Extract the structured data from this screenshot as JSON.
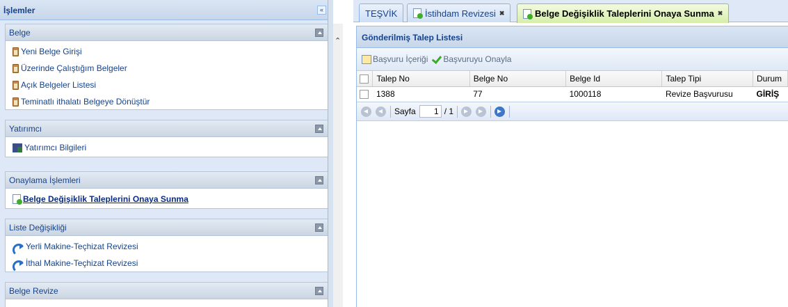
{
  "west": {
    "title": "İşlemler",
    "collapse_glyph": "«",
    "panels": [
      {
        "title": "Belge",
        "items": [
          {
            "label": "Yeni Belge Girişi",
            "icon": "clipboard-icon"
          },
          {
            "label": "Üzerinde Çalıştığım Belgeler",
            "icon": "clipboard-icon"
          },
          {
            "label": "Açık Belgeler Listesi",
            "icon": "clipboard-icon"
          },
          {
            "label": "Teminatlı ithalatı Belgeye Dönüştür",
            "icon": "clipboard-icon"
          }
        ]
      },
      {
        "title": "Yatırımcı",
        "items": [
          {
            "label": "Yatırımcı Bilgileri",
            "icon": "building-icon"
          }
        ]
      },
      {
        "title": "Onaylama İşlemleri",
        "items": [
          {
            "label": "Belge Değişiklik Taleplerini Onaya Sunma",
            "icon": "document-go-icon"
          }
        ]
      },
      {
        "title": "Liste Değişikliği",
        "items": [
          {
            "label": "Yerli Makine-Teçhizat Revizesi",
            "icon": "redo-arrow-icon"
          },
          {
            "label": "İthal Makine-Teçhizat Revizesi",
            "icon": "redo-arrow-icon"
          }
        ]
      },
      {
        "title": "Belge Revize",
        "items": []
      }
    ]
  },
  "tabs": [
    {
      "label": "TEŞVİK"
    },
    {
      "label": "İstihdam Revizesi",
      "close": "✖"
    },
    {
      "label": "Belge Değişiklik Taleplerini Onaya Sunma",
      "close": "✖"
    }
  ],
  "grid": {
    "title": "Gönderilmiş Talep Listesi",
    "toolbar": {
      "content_label": "Başvuru İçeriği",
      "approve_label": "Başvuruyu Onayla"
    },
    "columns": [
      "Talep No",
      "Belge No",
      "Belge Id",
      "Talep Tipi",
      "Durum"
    ],
    "rows": [
      {
        "talep_no": "1388",
        "belge_no": "77",
        "belge_id": "1000118",
        "talep_tipi": "Revize Başvurusu",
        "durum": "GİRİŞ"
      }
    ]
  },
  "pager": {
    "page_label": "Sayfa",
    "page_value": "1",
    "of_label": "/ 1"
  },
  "colors": {
    "header_text": "#15428b",
    "panel_bg": "#dfe8f6",
    "active_tab": "#d6eeaa"
  }
}
